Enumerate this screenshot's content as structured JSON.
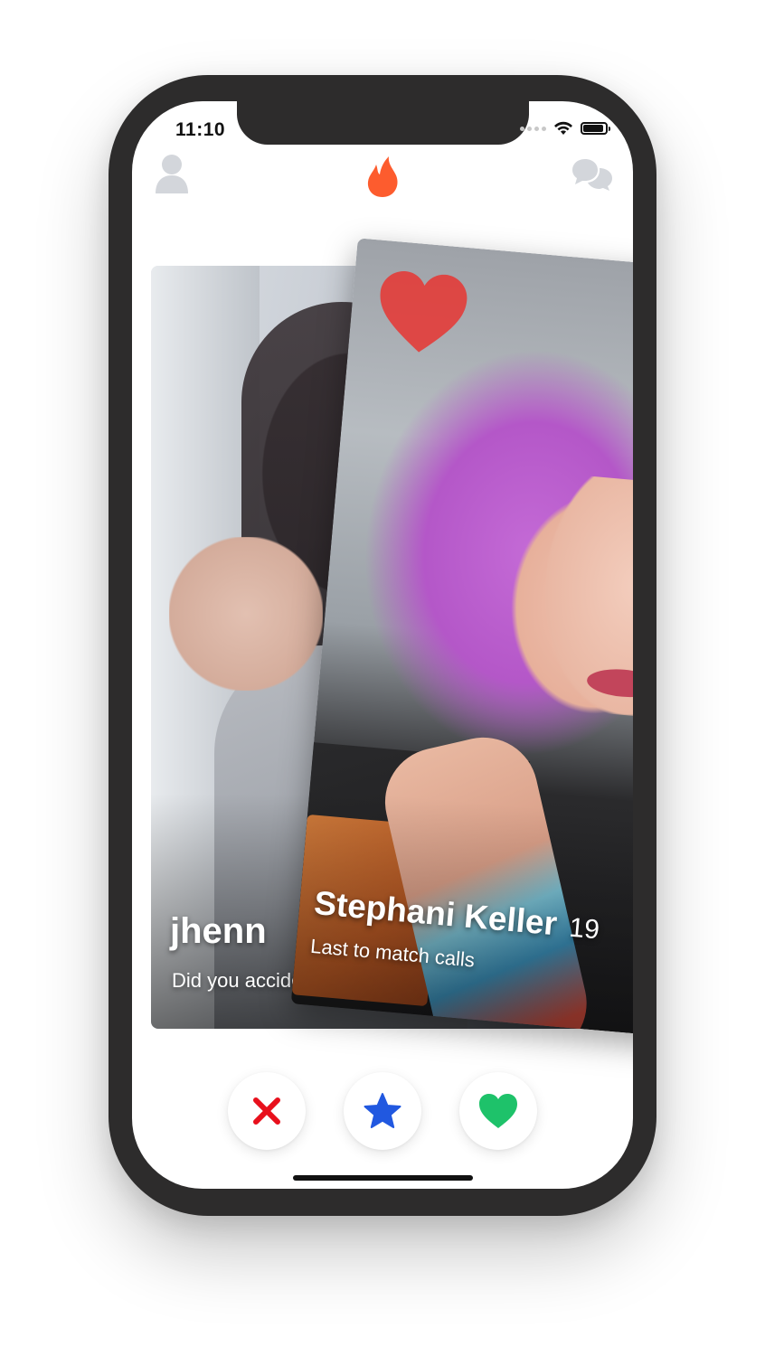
{
  "status_bar": {
    "time": "11:10"
  },
  "nav": {
    "profile_icon": "person-icon",
    "logo_icon": "flame-icon",
    "messages_icon": "chat-bubbles-icon"
  },
  "cards": {
    "back": {
      "name": "jhenn",
      "bio": "Did you accidentally like me?"
    },
    "front": {
      "name": "Stephani Keller",
      "age": "19",
      "bio": "Last to match calls",
      "stamp_icon": "heart-icon"
    }
  },
  "actions": {
    "nope_icon": "x-icon",
    "super_like_icon": "star-icon",
    "like_icon": "heart-icon"
  },
  "colors": {
    "brand": "#fd5c2e",
    "nope": "#e8101c",
    "super_like": "#2158e0",
    "like": "#1ec26a",
    "like_stamp": "#e53935",
    "inactive_icon": "#d3d6db"
  }
}
